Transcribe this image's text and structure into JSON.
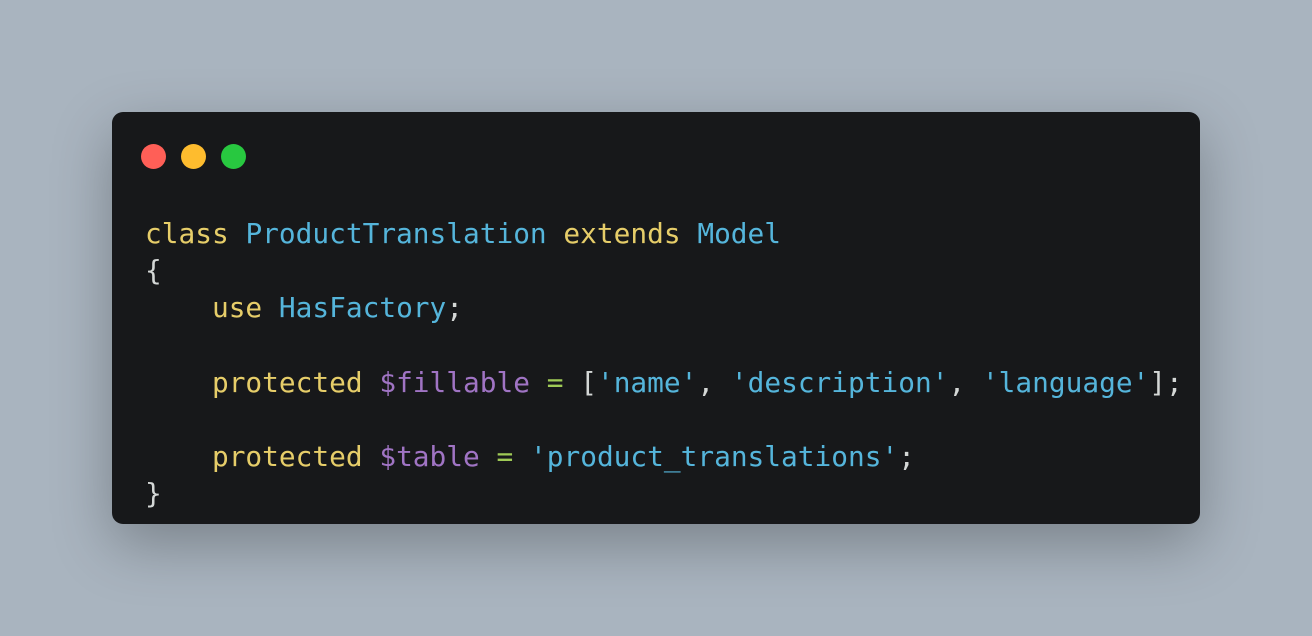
{
  "window": {
    "controls": [
      "close",
      "minimize",
      "maximize"
    ]
  },
  "code": {
    "line1": {
      "kw_class": "class",
      "class_name": "ProductTranslation",
      "kw_extends": "extends",
      "parent": "Model"
    },
    "line2": {
      "brace_open": "{"
    },
    "line3": {
      "kw_use": "use",
      "trait": "HasFactory",
      "semicolon": ";"
    },
    "line5": {
      "kw_protected": "protected",
      "var": "$fillable",
      "eq": "=",
      "bracket_open": "[",
      "items": [
        "'name'",
        "'description'",
        "'language'"
      ],
      "comma": ",",
      "bracket_close": "]",
      "semicolon": ";"
    },
    "line7": {
      "kw_protected": "protected",
      "var": "$table",
      "eq": "=",
      "value": "'product_translations'",
      "semicolon": ";"
    },
    "line8": {
      "brace_close": "}"
    }
  },
  "colors": {
    "background": "#a9b4bf",
    "window": "#17181a",
    "keyword": "#e6cd69",
    "class": "#55b5db",
    "variable": "#a074c4",
    "operator": "#9fca56",
    "string": "#55b5db",
    "punctuation": "#d4d7d6",
    "close_dot": "#ff5f57",
    "minimize_dot": "#febc2e",
    "maximize_dot": "#28c840"
  }
}
